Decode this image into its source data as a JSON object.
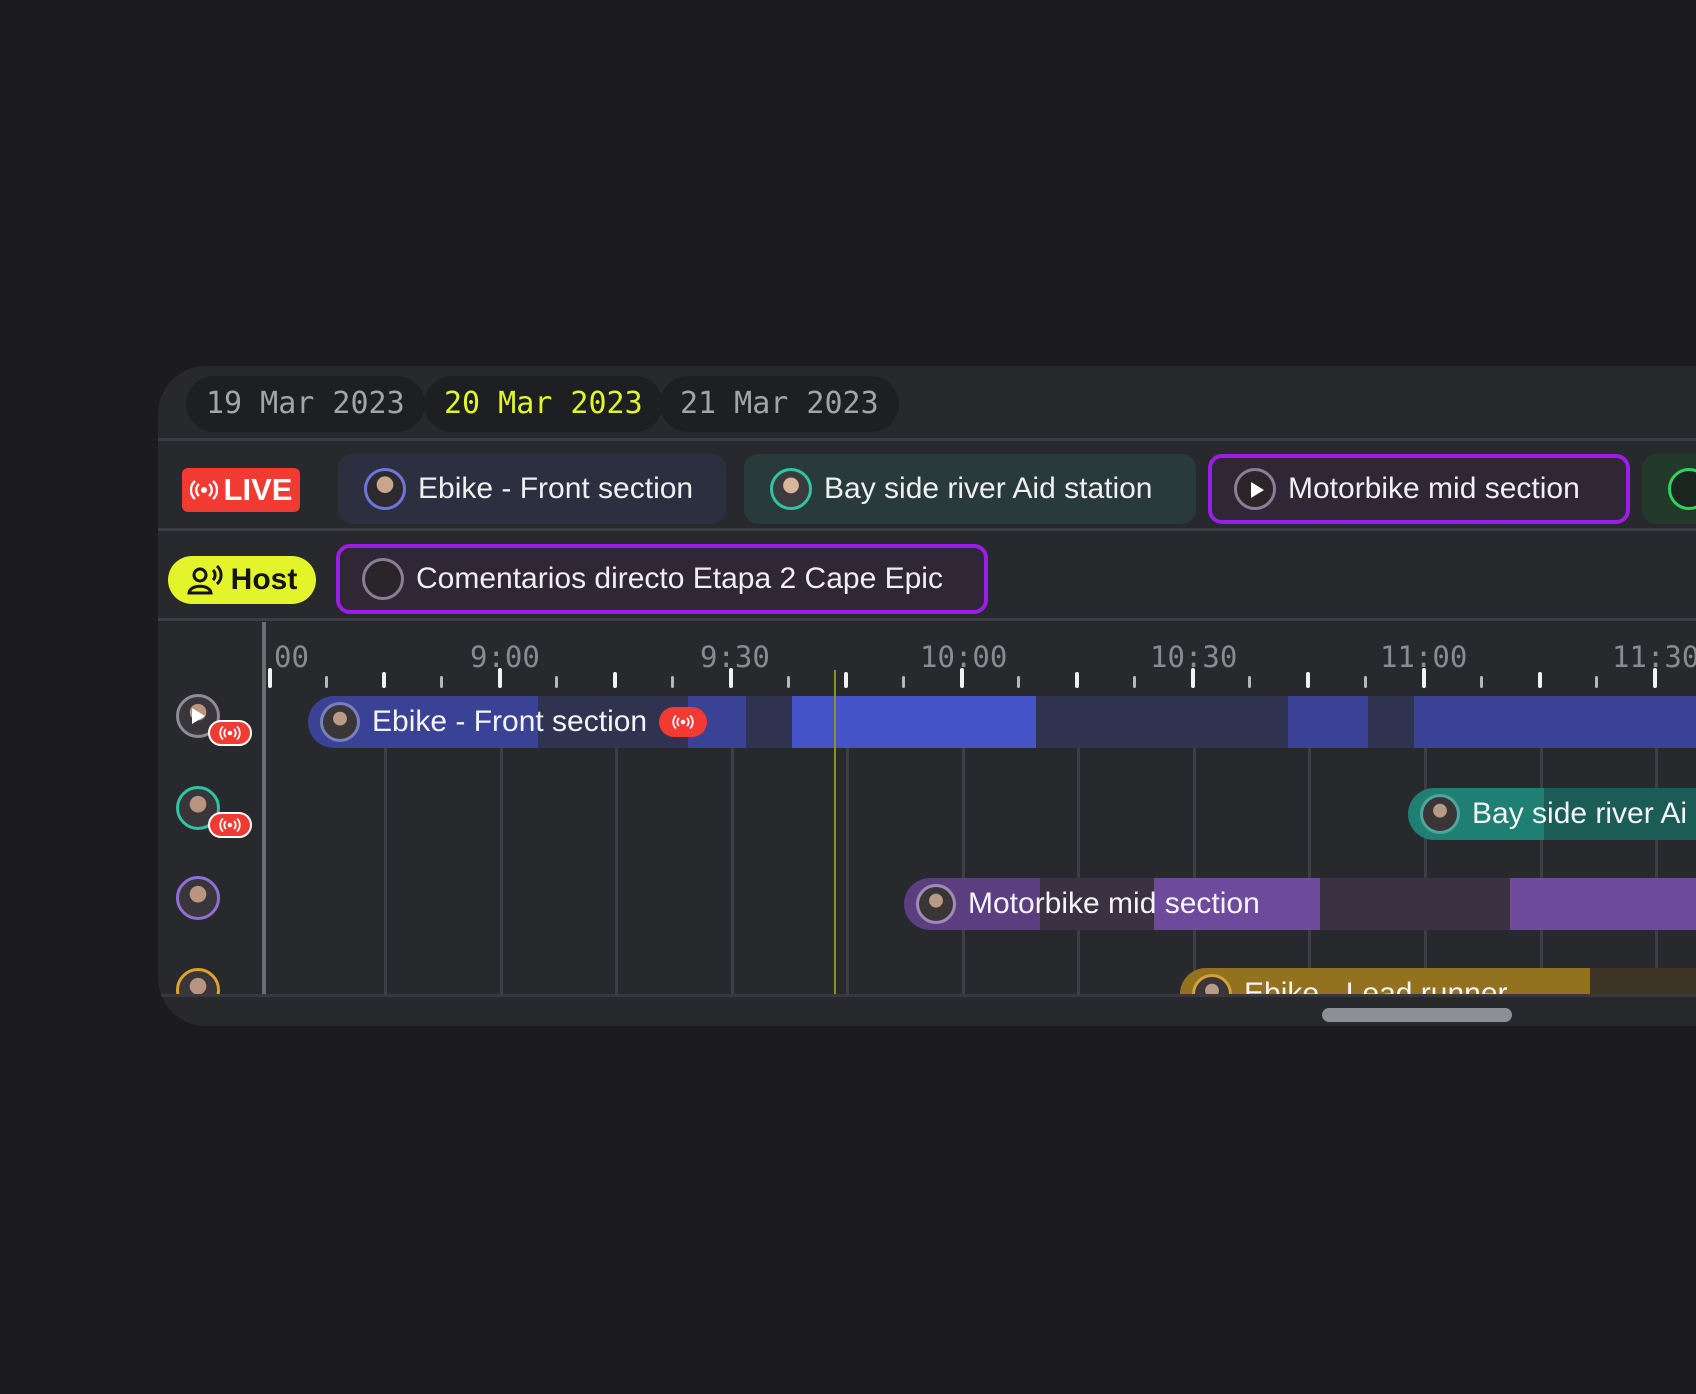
{
  "date_tabs": [
    {
      "label": "19 Mar 2023",
      "active": false
    },
    {
      "label": "20 Mar 2023",
      "active": true
    },
    {
      "label": "21 Mar 2023",
      "active": false
    }
  ],
  "live_row": {
    "badge": "LIVE",
    "streams": [
      {
        "label": "Ebike - Front section",
        "style": "blue"
      },
      {
        "label": "Bay side river Aid station",
        "style": "teal"
      },
      {
        "label": "Motorbike mid section",
        "style": "purple",
        "selected": true,
        "icon": "play-icon"
      },
      {
        "label": "",
        "style": "green"
      }
    ]
  },
  "host_row": {
    "badge": "Host",
    "streams": [
      {
        "label": "Comentarios directo Etapa 2 Cape Epic",
        "style": "purple",
        "selected": true
      }
    ]
  },
  "timeline": {
    "time_labels": [
      "00",
      "9:00",
      "9:30",
      "10:00",
      "10:30",
      "11:00",
      "11:30"
    ],
    "tracks": [
      {
        "label": "Ebike - Front section",
        "color": "#4553c9",
        "live": true
      },
      {
        "label": "Bay side river Ai",
        "color": "#1f7f73",
        "live": true
      },
      {
        "label": "Motorbike mid section",
        "color": "#6e4a9c",
        "live": false
      },
      {
        "label": "Ebike - Lead runner",
        "color": "#93721f",
        "live": true
      }
    ]
  },
  "colors": {
    "background": "#1c1c1e",
    "panel": "#28292d",
    "accent_yellow": "#e3f52a",
    "live_red": "#f03a32",
    "select_purple": "#9a1ee8"
  }
}
